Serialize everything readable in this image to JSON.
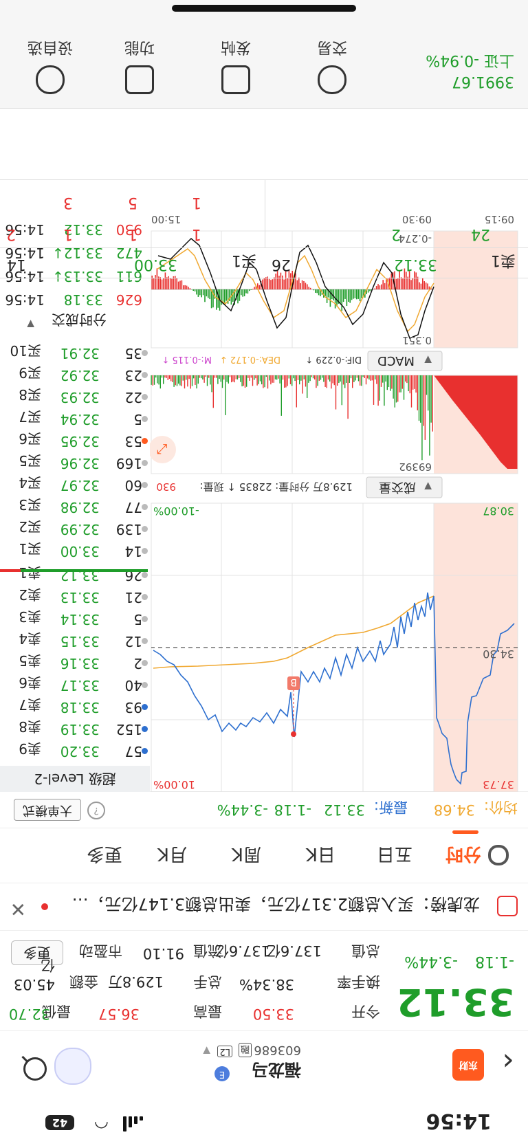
{
  "status_bar": {
    "time": "14:56",
    "battery": "42"
  },
  "header": {
    "stock_name": "福龙马",
    "stock_code": "603686",
    "tags": [
      "融",
      "L2"
    ]
  },
  "quote": {
    "price": "33.12",
    "change": "-1.18",
    "change_pct": "-3.44%",
    "open_label": "今开",
    "open": "33.50",
    "high_label": "最高",
    "high": "36.57",
    "low_label": "最低",
    "low": "32.70",
    "turnover_label": "换手率",
    "turnover": "38.34%",
    "volume_label": "总手",
    "volume": "129.8万",
    "amount_label": "金额",
    "amount": "45.03亿",
    "total_value_label": "总值",
    "total_value": "137.6亿",
    "float_value_label": "流值",
    "float_value": "137.6亿",
    "pe_label": "市盈动",
    "pe": "91.10",
    "more": "更多"
  },
  "dragon_tiger": {
    "text": "龙虎榜：买入总额2.317亿元，卖出总额3.147亿元，…"
  },
  "tabs": [
    "分时",
    "五日",
    "日K",
    "周K",
    "月K",
    "更多"
  ],
  "info_line": {
    "avg_label": "均价:",
    "avg": "34.68",
    "last_label": "最新:",
    "last": "33.12",
    "chg": "-1.18",
    "chg_pct": "-3.44%",
    "big_order": "大单模式"
  },
  "level2_label": "超级 Level-2",
  "price_chart": {
    "top_left": "37.73",
    "top_right": "10.00%",
    "ref_price": "34.30",
    "bottom_left": "30.87",
    "bottom_right": "-10.00%",
    "buy_marker": "B"
  },
  "volume_panel": {
    "label": "成交量",
    "info": "129.8万 分时量: 22835 ↑ 现量:",
    "current": "930",
    "max": "69392"
  },
  "macd_panel": {
    "label": "MACD",
    "dif": "DIF:-0.229 ↑",
    "dea": "DEA:-0.172 ↓",
    "m": "M:-0.115 ↑",
    "top_val": "0.351",
    "bottom_val": "-0.274",
    "times": [
      "09:15",
      "09:30",
      "15:00"
    ]
  },
  "order_book": {
    "asks": [
      {
        "label": "卖9",
        "price": "33.20",
        "vol": "57"
      },
      {
        "label": "卖8",
        "price": "33.19",
        "vol": "152"
      },
      {
        "label": "卖7",
        "price": "33.18",
        "vol": "93"
      },
      {
        "label": "卖6",
        "price": "33.17",
        "vol": "40"
      },
      {
        "label": "卖5",
        "price": "33.16",
        "vol": "2"
      },
      {
        "label": "卖4",
        "price": "33.15",
        "vol": "12"
      },
      {
        "label": "卖3",
        "price": "33.14",
        "vol": "5"
      },
      {
        "label": "卖2",
        "price": "33.13",
        "vol": "21"
      },
      {
        "label": "卖1",
        "price": "33.12",
        "vol": "26"
      }
    ],
    "bids": [
      {
        "label": "买1",
        "price": "33.00",
        "vol": "14"
      },
      {
        "label": "买2",
        "price": "32.99",
        "vol": "139"
      },
      {
        "label": "买3",
        "price": "32.98",
        "vol": "77"
      },
      {
        "label": "买4",
        "price": "32.97",
        "vol": "60"
      },
      {
        "label": "买5",
        "price": "32.96",
        "vol": "169"
      },
      {
        "label": "买6",
        "price": "32.95",
        "vol": "53"
      },
      {
        "label": "买7",
        "price": "32.94",
        "vol": "5"
      },
      {
        "label": "买8",
        "price": "32.93",
        "vol": "22"
      },
      {
        "label": "买9",
        "price": "32.92",
        "vol": "23"
      },
      {
        "label": "买10",
        "price": "32.91",
        "vol": "35"
      }
    ]
  },
  "ticks": {
    "label": "分时成交",
    "rows": [
      {
        "time": "14:56",
        "price": "33.18",
        "vol": "626"
      },
      {
        "time": "14:56",
        "price": "33.13↓",
        "vol": "611"
      },
      {
        "time": "14:56",
        "price": "33.12↓",
        "vol": "472"
      },
      {
        "time": "14:56",
        "price": "33.12",
        "vol": "930"
      }
    ]
  },
  "depth": {
    "sell_label": "卖1",
    "sell_price": "33.12",
    "sell_vol": "26",
    "buy_label": "买1",
    "buy_price": "33.00",
    "buy_vol": "14",
    "sell_queue_1": [
      "24",
      "2"
    ],
    "buy_queue_1": [
      "1",
      "1",
      "1",
      "2"
    ],
    "buy_queue_2": [
      "1",
      "5",
      "3"
    ]
  },
  "bottom_bar": {
    "index_name": "上证 -0.94%",
    "index_value": "3991.67",
    "tools": [
      "交易",
      "发帖",
      "功能",
      "设自选"
    ]
  },
  "colors": {
    "up": "#e8302f",
    "down": "#1f9d2a",
    "accent": "#ff5a1f",
    "price_line": "#2d6fcf",
    "avg_line": "#f0a830"
  }
}
